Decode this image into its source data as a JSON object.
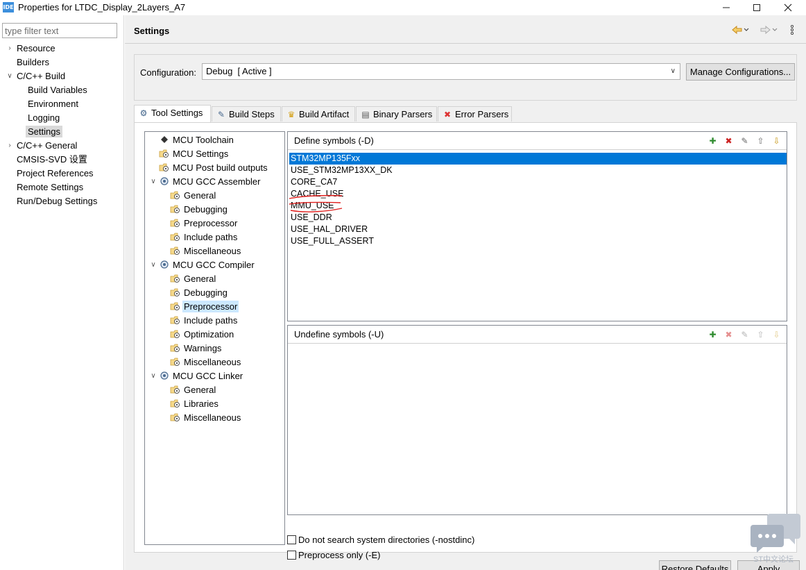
{
  "window": {
    "app_icon_text": "IDE",
    "title": "Properties for LTDC_Display_2Layers_A7",
    "minimize_icon": "minimize-icon",
    "maximize_icon": "maximize-icon",
    "close_icon": "close-icon"
  },
  "sidebar": {
    "filter_placeholder": "type filter text",
    "items": [
      {
        "label": "Resource",
        "expander": "collapsed"
      },
      {
        "label": "Builders"
      },
      {
        "label": "C/C++ Build",
        "expander": "expanded"
      },
      {
        "label": "Build Variables"
      },
      {
        "label": "Environment"
      },
      {
        "label": "Logging"
      },
      {
        "label": "Settings",
        "selected": true
      },
      {
        "label": "C/C++ General",
        "expander": "collapsed"
      },
      {
        "label": "CMSIS-SVD 设置"
      },
      {
        "label": "Project References"
      },
      {
        "label": "Remote Settings"
      },
      {
        "label": "Run/Debug Settings"
      }
    ]
  },
  "header": {
    "title": "Settings",
    "back_icon": "back-arrow-icon",
    "forward_icon": "forward-arrow-icon",
    "menu_icon": "view-menu-icon"
  },
  "configuration": {
    "label": "Configuration:",
    "selected": "Debug  [ Active ]",
    "manage_button": "Manage Configurations..."
  },
  "tabs": [
    {
      "label": "Tool Settings",
      "icon": "tool-settings-icon",
      "active": true
    },
    {
      "label": "Build Steps",
      "icon": "build-steps-icon"
    },
    {
      "label": "Build Artifact",
      "icon": "build-artifact-icon"
    },
    {
      "label": "Binary Parsers",
      "icon": "binary-parsers-icon"
    },
    {
      "label": "Error Parsers",
      "icon": "error-parsers-icon"
    }
  ],
  "tool_tree": [
    {
      "label": "MCU Toolchain",
      "level": 0
    },
    {
      "label": "MCU Settings",
      "level": 0
    },
    {
      "label": "MCU Post build outputs",
      "level": 0
    },
    {
      "label": "MCU GCC Assembler",
      "level": 0,
      "expander": "expanded"
    },
    {
      "label": "General",
      "level": 1
    },
    {
      "label": "Debugging",
      "level": 1
    },
    {
      "label": "Preprocessor",
      "level": 1
    },
    {
      "label": "Include paths",
      "level": 1
    },
    {
      "label": "Miscellaneous",
      "level": 1
    },
    {
      "label": "MCU GCC Compiler",
      "level": 0,
      "expander": "expanded"
    },
    {
      "label": "General",
      "level": 1
    },
    {
      "label": "Debugging",
      "level": 1
    },
    {
      "label": "Preprocessor",
      "level": 1,
      "selected": true
    },
    {
      "label": "Include paths",
      "level": 1
    },
    {
      "label": "Optimization",
      "level": 1
    },
    {
      "label": "Warnings",
      "level": 1
    },
    {
      "label": "Miscellaneous",
      "level": 1
    },
    {
      "label": "MCU GCC Linker",
      "level": 0,
      "expander": "expanded"
    },
    {
      "label": "General",
      "level": 1
    },
    {
      "label": "Libraries",
      "level": 1
    },
    {
      "label": "Miscellaneous",
      "level": 1
    }
  ],
  "define_symbols": {
    "title": "Define symbols (-D)",
    "tools": [
      "add-icon",
      "delete-icon",
      "edit-icon",
      "move-up-icon",
      "move-down-icon"
    ],
    "items": [
      {
        "value": "STM32MP135Fxx",
        "selected": true
      },
      {
        "value": "USE_STM32MP13XX_DK"
      },
      {
        "value": "CORE_CA7"
      },
      {
        "value": "CACHE_USE",
        "annotated": true
      },
      {
        "value": "MMU_USE",
        "annotated": true
      },
      {
        "value": "USE_DDR"
      },
      {
        "value": "USE_HAL_DRIVER"
      },
      {
        "value": "USE_FULL_ASSERT"
      }
    ],
    "annotation_color": "#e0201e"
  },
  "undefine_symbols": {
    "title": "Undefine symbols (-U)",
    "tools": [
      "add-icon",
      "delete-icon",
      "edit-icon",
      "move-up-icon",
      "move-down-icon"
    ],
    "items": []
  },
  "options": {
    "nostdinc": {
      "label": "Do not search system directories (-nostdinc)",
      "checked": false
    },
    "preprocess_only": {
      "label": "Preprocess only (-E)",
      "checked": false
    }
  },
  "buttons": {
    "restore_defaults": "Restore Defaults",
    "apply": "Apply"
  },
  "watermark": {
    "text": "ST中文论坛",
    "icon": "chat-bubbles-icon"
  },
  "colors": {
    "selection_blue": "#0078d7",
    "tree_selection": "#cce8ff",
    "panel_bg": "#f0f0f0"
  }
}
